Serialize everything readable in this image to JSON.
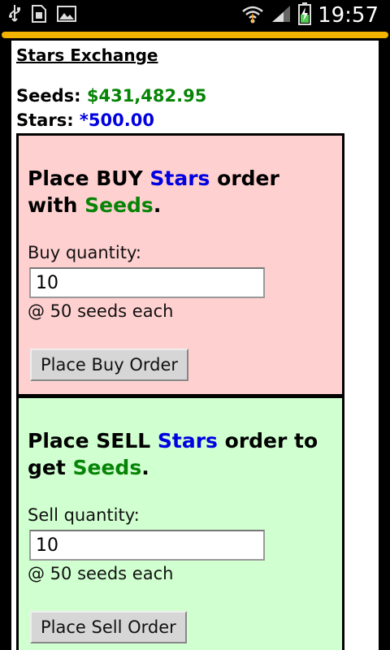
{
  "status_bar": {
    "time": "19:57",
    "icons": [
      "usb-icon",
      "sim-card-icon",
      "gallery-icon",
      "wifi-icon",
      "signal-icon",
      "battery-charging-icon"
    ]
  },
  "page": {
    "title": "Stars Exchange",
    "balances": {
      "seeds_label": "Seeds:",
      "seeds_value": "$431,482.95",
      "stars_label": "Stars:",
      "stars_value": "*500.00"
    },
    "buy": {
      "heading_1": "Place BUY ",
      "heading_stars": "Stars",
      "heading_2": " order with ",
      "heading_seeds": "Seeds",
      "heading_end": ".",
      "quantity_label": "Buy quantity:",
      "quantity_value": "10",
      "price_text": "@ 50 seeds each",
      "button_label": "Place Buy Order"
    },
    "sell": {
      "heading_1": "Place SELL ",
      "heading_stars": "Stars",
      "heading_2": " order to get ",
      "heading_seeds": "Seeds",
      "heading_end": ".",
      "quantity_label": "Sell quantity:",
      "quantity_value": "10",
      "price_text": "@ 50 seeds each",
      "button_label": "Place Sell Order"
    }
  },
  "colors": {
    "seeds": "#068406",
    "stars": "#0000e0",
    "buy_panel": "#ffd0d0",
    "sell_panel": "#d0ffd0",
    "accent_bar": "#f2b200"
  }
}
